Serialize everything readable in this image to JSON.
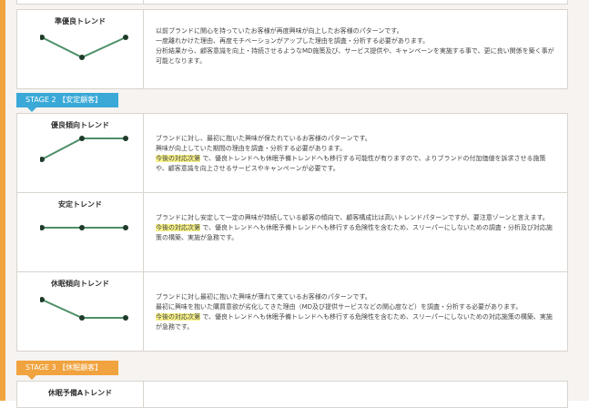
{
  "stages": [
    {
      "label": "STAGE 2 【安定顧客】",
      "color": "#3aa9d8"
    },
    {
      "label": "STAGE 3 【休眠顧客】",
      "color": "#f0a33e"
    }
  ],
  "highlight_label": "今後の対応次第",
  "rows": [
    {
      "title": "準優良トレンド",
      "lines": [
        "以前ブランドに関心を持っていたお客様が再度興味が向上したお客様のパターンです。",
        "一度離れかけた理由、再度モチベーションがアップした理由を調査・分析する必要があります。",
        "分析結果から、顧客意識を向上・持続させるようなMD施策及び、サービス提供や、キャンペーンを実施する事で、更に良い関係を築く事が可能となります。"
      ]
    },
    {
      "title": "優良傾向トレンド",
      "lines": [
        "ブランドに対し、最初に抱いた興味が保たれているお客様のパターンです。",
        "興味が向上していた期間の理由を調査・分析する必要があります。"
      ],
      "hl_text": "で、優良トレンドへも休眠予備トレンドへも移行する可能性が有りますので、よりブランドの付加価値を訴求させる施策や、顧客意識を向上させるサービスやキャンペーンが必要です。"
    },
    {
      "title": "安定トレンド",
      "lines": [
        "ブランドに対し安定して一定の興味が持続している顧客の傾向で、顧客構成比は高いトレンドパターンですが、要注意ゾーンと言えます。"
      ],
      "hl_text": "で、優良トレンドへも休眠予備トレンドへも移行する危険性を含むため、スリーパーにしないための調査・分析及び対応施策の構築、実施が急務です。"
    },
    {
      "title": "休眠傾向トレンド",
      "lines": [
        "ブランドに対し最初に抱いた興味が薄れて来ているお客様のパターンです。",
        "最初に興味を抱いた購買意欲が劣化してきた理由（MD及び提供サービスなどの関心度など）を調査・分析する必要があります。"
      ],
      "hl_text": "で、優良トレンドへも休眠予備トレンドへも移行する危険性を含むため、スリーパーにしないための対応施策の構築、実施が急務です。"
    },
    {
      "title": "休眠予備Aトレンド"
    }
  ]
}
